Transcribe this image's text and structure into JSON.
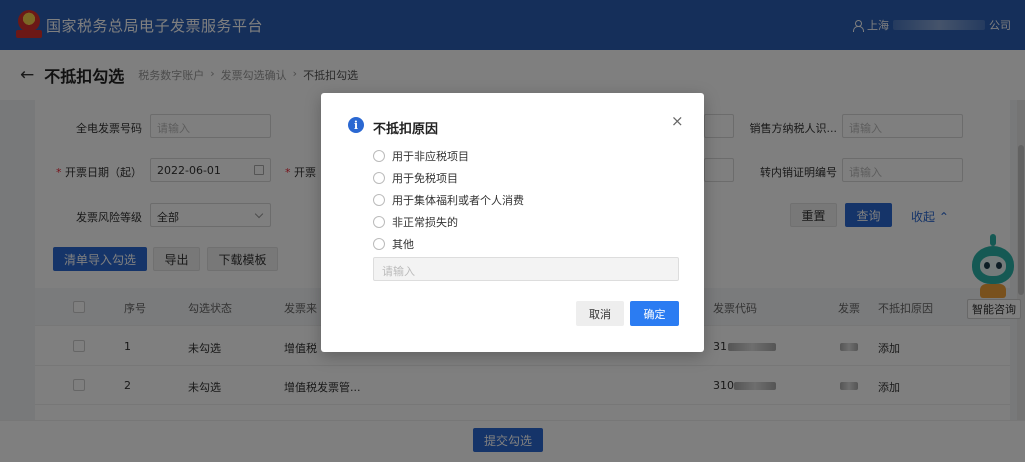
{
  "header": {
    "app_title": "国家税务总局电子发票服务平台",
    "user_prefix": "上海",
    "user_suffix": "公司"
  },
  "titlebar": {
    "page_title": "不抵扣勾选",
    "breadcrumb": [
      "税务数字账户",
      "发票勾选确认",
      "不抵扣勾选"
    ]
  },
  "filters": {
    "invoice_no_label": "全电发票号码",
    "invoice_no_placeholder": "请输入",
    "date_start_label": "开票日期（起）",
    "date_start_value": "2022-06-01",
    "date_end_label": "开票",
    "risk_label": "发票风险等级",
    "risk_value": "全部",
    "seller_tax_label": "销售方纳税人识...",
    "seller_tax_placeholder": "请输入",
    "transfer_label": "转内销证明编号",
    "transfer_placeholder": "请输入"
  },
  "buttons": {
    "reset": "重置",
    "query": "查询",
    "collapse": "收起",
    "list_import": "清单导入勾选",
    "export": "导出",
    "download_template": "下载模板",
    "submit": "提交勾选"
  },
  "table": {
    "headers": [
      "序号",
      "勾选状态",
      "发票来",
      "发票代码",
      "发票",
      "不抵扣原因"
    ],
    "rows": [
      {
        "index": "1",
        "status": "未勾选",
        "source": "增值税",
        "code_prefix": "31",
        "action": "添加"
      },
      {
        "index": "2",
        "status": "未勾选",
        "source": "增值税发票管...",
        "code_prefix": "310",
        "action": "添加"
      }
    ]
  },
  "assistant": {
    "label": "智能咨询"
  },
  "modal": {
    "title": "不抵扣原因",
    "options": [
      "用于非应税项目",
      "用于免税项目",
      "用于集体福利或者个人消费",
      "非正常损失的",
      "其他"
    ],
    "reason_placeholder": "请输入",
    "cancel": "取消",
    "confirm": "确定"
  },
  "colors": {
    "header_bg": "#2b5fb4",
    "primary": "#2b68d2",
    "confirm": "#2b7cf2"
  }
}
